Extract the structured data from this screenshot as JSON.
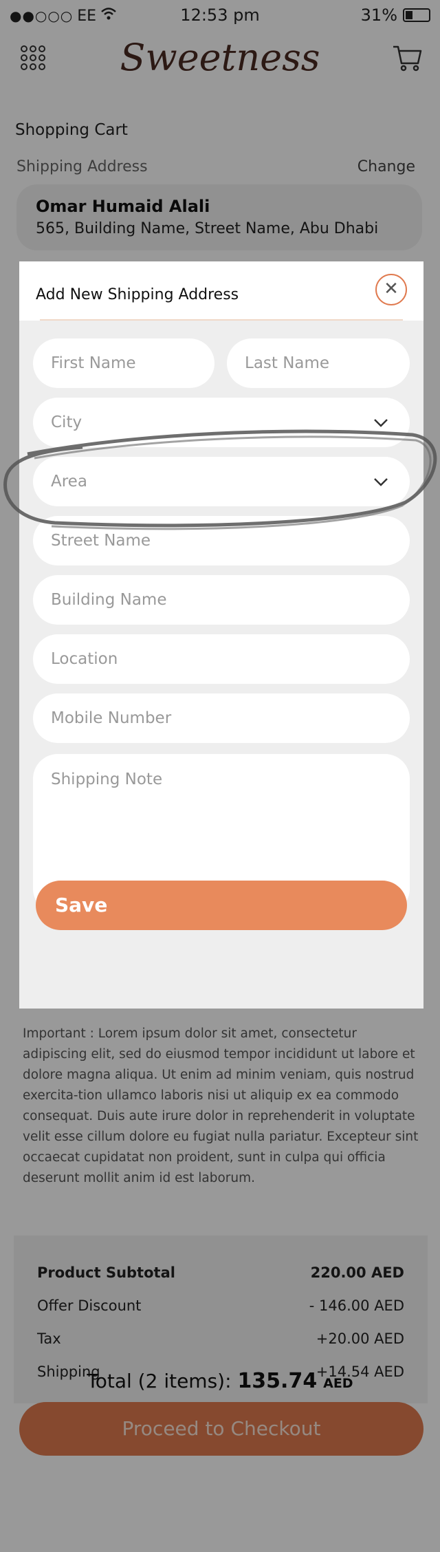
{
  "status_bar": {
    "carrier": "EE",
    "time": "12:53 pm",
    "battery": "31%"
  },
  "header": {
    "logo": "Sweetness",
    "menu_icon": "grid-menu-icon",
    "cart_icon": "cart-icon"
  },
  "page": {
    "title": "Shopping Cart",
    "shipping_label": "Shipping Address",
    "change_label": "Change",
    "address": {
      "name": "Omar Humaid Alali",
      "line": "565,  Building Name, Street Name, Abu Dhabi"
    }
  },
  "modal": {
    "title": "Add New Shipping Address",
    "close_icon": "close-icon",
    "fields": {
      "first_name": "First Name",
      "last_name": "Last Name",
      "city": "City",
      "area": "Area",
      "street": "Street Name",
      "building": "Building Name",
      "location": "Location",
      "mobile": "Mobile Number",
      "note": "Shipping Note"
    },
    "save_label": "Save"
  },
  "important_text": "Important : Lorem ipsum dolor sit amet, consectetur adipiscing elit, sed do eiusmod tempor incididunt ut labore et dolore magna aliqua. Ut enim ad minim veniam, quis nostrud exercita-tion ullamco laboris nisi ut aliquip ex ea commodo consequat. Duis aute irure dolor in reprehenderit in voluptate velit esse cillum dolore eu fugiat nulla pariatur. Excepteur sint occaecat cupidatat non proident, sunt in culpa qui officia deserunt mollit anim id est laborum.",
  "totals": {
    "rows": [
      {
        "label": "Product Subtotal",
        "value": "220.00 AED"
      },
      {
        "label": "Offer Discount",
        "value": "- 146.00 AED"
      },
      {
        "label": "Tax",
        "value": "+20.00 AED"
      },
      {
        "label": "Shipping",
        "value": "+14.54 AED"
      }
    ],
    "total_prefix": "Total (2 items):",
    "total_amount": "135.74",
    "total_currency": "AED",
    "checkout_label": "Proceed to Checkout"
  },
  "colors": {
    "accent": "#e88a5c",
    "logo": "#4a2a22"
  }
}
